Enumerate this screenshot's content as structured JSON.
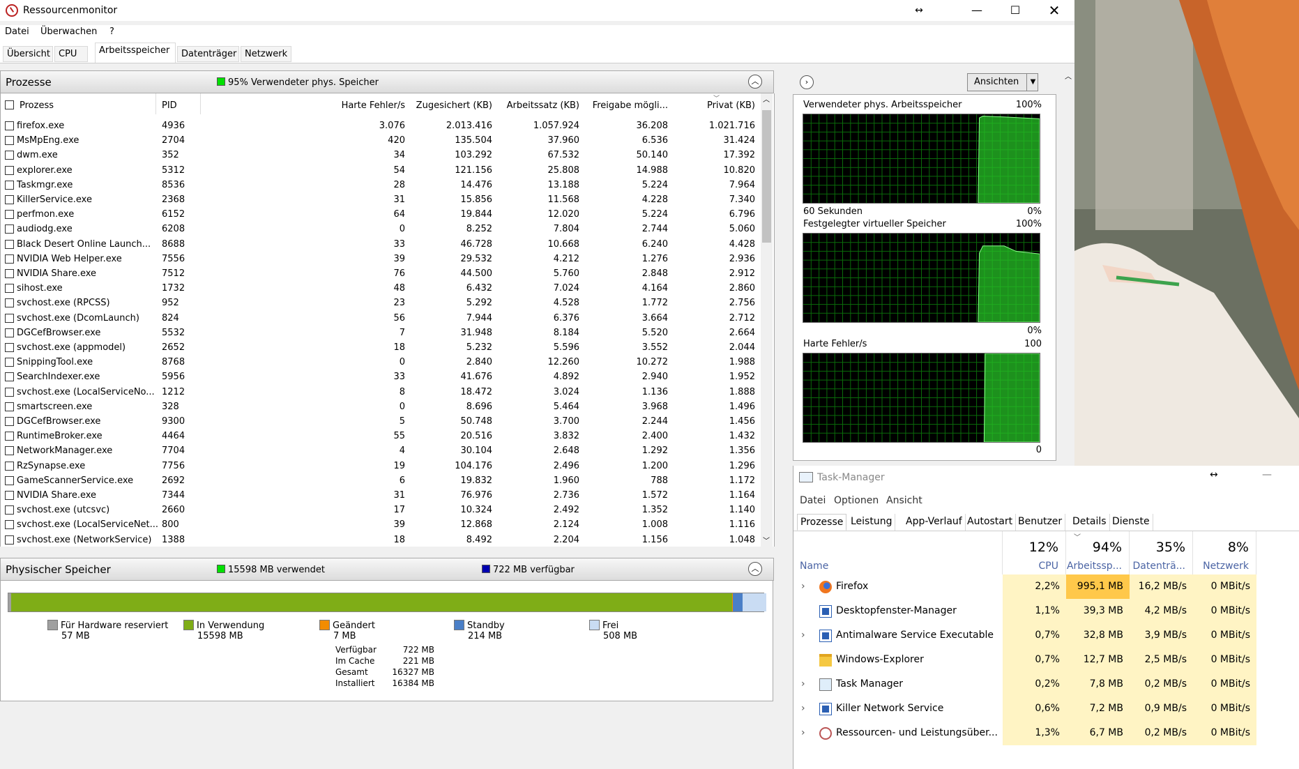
{
  "window": {
    "title": "Ressourcenmonitor"
  },
  "menu": [
    "Datei",
    "Überwachen",
    "?"
  ],
  "tabs": [
    "Übersicht",
    "CPU",
    "Arbeitsspeicher",
    "Datenträger",
    "Netzwerk"
  ],
  "processes": {
    "title": "Prozesse",
    "status": "95% Verwendeter phys. Speicher",
    "columns": [
      "Prozess",
      "PID",
      "Harte Fehler/s",
      "Zugesichert (KB)",
      "Arbeitssatz (KB)",
      "Freigabe mögli...",
      "Privat (KB)"
    ],
    "rows": [
      [
        "firefox.exe",
        "4936",
        "3.076",
        "2.013.416",
        "1.057.924",
        "36.208",
        "1.021.716"
      ],
      [
        "MsMpEng.exe",
        "2704",
        "420",
        "135.504",
        "37.960",
        "6.536",
        "31.424"
      ],
      [
        "dwm.exe",
        "352",
        "34",
        "103.292",
        "67.532",
        "50.140",
        "17.392"
      ],
      [
        "explorer.exe",
        "5312",
        "54",
        "121.156",
        "25.808",
        "14.988",
        "10.820"
      ],
      [
        "Taskmgr.exe",
        "8536",
        "28",
        "14.476",
        "13.188",
        "5.224",
        "7.964"
      ],
      [
        "KillerService.exe",
        "2368",
        "31",
        "15.856",
        "11.568",
        "4.228",
        "7.340"
      ],
      [
        "perfmon.exe",
        "6152",
        "64",
        "19.844",
        "12.020",
        "5.224",
        "6.796"
      ],
      [
        "audiodg.exe",
        "6208",
        "0",
        "8.252",
        "7.804",
        "2.744",
        "5.060"
      ],
      [
        "Black Desert Online Launch...",
        "8688",
        "33",
        "46.728",
        "10.668",
        "6.240",
        "4.428"
      ],
      [
        "NVIDIA Web Helper.exe",
        "7556",
        "39",
        "29.532",
        "4.212",
        "1.276",
        "2.936"
      ],
      [
        "NVIDIA Share.exe",
        "7512",
        "76",
        "44.500",
        "5.760",
        "2.848",
        "2.912"
      ],
      [
        "sihost.exe",
        "1732",
        "48",
        "6.432",
        "7.024",
        "4.164",
        "2.860"
      ],
      [
        "svchost.exe (RPCSS)",
        "952",
        "23",
        "5.292",
        "4.528",
        "1.772",
        "2.756"
      ],
      [
        "svchost.exe (DcomLaunch)",
        "824",
        "56",
        "7.944",
        "6.376",
        "3.664",
        "2.712"
      ],
      [
        "DGCefBrowser.exe",
        "5532",
        "7",
        "31.948",
        "8.184",
        "5.520",
        "2.664"
      ],
      [
        "svchost.exe (appmodel)",
        "2652",
        "18",
        "5.232",
        "5.596",
        "3.552",
        "2.044"
      ],
      [
        "SnippingTool.exe",
        "8768",
        "0",
        "2.840",
        "12.260",
        "10.272",
        "1.988"
      ],
      [
        "SearchIndexer.exe",
        "5956",
        "33",
        "41.676",
        "4.892",
        "2.940",
        "1.952"
      ],
      [
        "svchost.exe (LocalServiceNo...",
        "1212",
        "8",
        "18.472",
        "3.024",
        "1.136",
        "1.888"
      ],
      [
        "smartscreen.exe",
        "328",
        "0",
        "8.696",
        "5.464",
        "3.968",
        "1.496"
      ],
      [
        "DGCefBrowser.exe",
        "9300",
        "5",
        "50.748",
        "3.700",
        "2.244",
        "1.456"
      ],
      [
        "RuntimeBroker.exe",
        "4464",
        "55",
        "20.516",
        "3.832",
        "2.400",
        "1.432"
      ],
      [
        "NetworkManager.exe",
        "7704",
        "4",
        "30.104",
        "2.648",
        "1.292",
        "1.356"
      ],
      [
        "RzSynapse.exe",
        "7756",
        "19",
        "104.176",
        "2.496",
        "1.200",
        "1.296"
      ],
      [
        "GameScannerService.exe",
        "2692",
        "6",
        "19.832",
        "1.960",
        "788",
        "1.172"
      ],
      [
        "NVIDIA Share.exe",
        "7344",
        "31",
        "76.976",
        "2.736",
        "1.572",
        "1.164"
      ],
      [
        "svchost.exe (utcsvc)",
        "2660",
        "17",
        "10.324",
        "2.492",
        "1.352",
        "1.140"
      ],
      [
        "svchost.exe (LocalServiceNet...",
        "800",
        "39",
        "12.868",
        "2.124",
        "1.008",
        "1.116"
      ],
      [
        "svchost.exe (NetworkService)",
        "1388",
        "18",
        "8.492",
        "2.204",
        "1.156",
        "1.048"
      ]
    ]
  },
  "physical_memory": {
    "title": "Physischer Speicher",
    "used_label": "15598 MB verwendet",
    "avail_label": "722 MB verfügbar",
    "legend": [
      {
        "label": "Für Hardware reserviert",
        "value": "57 MB",
        "color": "#a0a0a0"
      },
      {
        "label": "In Verwendung",
        "value": "15598 MB",
        "color": "#7fad17"
      },
      {
        "label": "Geändert",
        "value": "7 MB",
        "color": "#f28c00"
      },
      {
        "label": "Standby",
        "value": "214 MB",
        "color": "#4a7fc7"
      },
      {
        "label": "Frei",
        "value": "508 MB",
        "color": "#c9dcf3"
      }
    ],
    "stats": [
      {
        "label": "Verfügbar",
        "value": "722 MB"
      },
      {
        "label": "Im Cache",
        "value": "221 MB"
      },
      {
        "label": "Gesamt",
        "value": "16327 MB"
      },
      {
        "label": "Installiert",
        "value": "16384 MB"
      }
    ],
    "bar_fractions": {
      "reserved": 0.0035,
      "in_use": 0.955,
      "modified": 0.0004,
      "standby": 0.013,
      "free": 0.031
    }
  },
  "graphs": {
    "views_button": "Ansichten",
    "g1": {
      "title": "Verwendeter phys. Arbeitsspeicher",
      "top": "100%",
      "bottom": "0%",
      "footer": "60 Sekunden"
    },
    "g2": {
      "title": "Festgelegter virtueller Speicher",
      "top": "100%",
      "bottom": "0%"
    },
    "g3": {
      "title": "Harte Fehler/s",
      "top": "100",
      "bottom": "0"
    }
  },
  "taskmgr": {
    "title": "Task-Manager",
    "menu": [
      "Datei",
      "Optionen",
      "Ansicht"
    ],
    "tabs": [
      "Prozesse",
      "Leistung",
      "App-Verlauf",
      "Autostart",
      "Benutzer",
      "Details",
      "Dienste"
    ],
    "name_header": "Name",
    "columns": [
      {
        "pct": "12%",
        "name": "CPU"
      },
      {
        "pct": "94%",
        "name": "Arbeitssp..."
      },
      {
        "pct": "35%",
        "name": "Datenträ..."
      },
      {
        "pct": "8%",
        "name": "Netzwerk"
      }
    ],
    "rows": [
      {
        "name": "Firefox",
        "expand": true,
        "icon": "firefox-icon",
        "cpu": "2,2%",
        "mem": "995,1 MB",
        "disk": "16,2 MB/s",
        "net": "0 MBit/s"
      },
      {
        "name": "Desktopfenster-Manager",
        "expand": false,
        "icon": "window-icon",
        "cpu": "1,1%",
        "mem": "39,3 MB",
        "disk": "4,2 MB/s",
        "net": "0 MBit/s"
      },
      {
        "name": "Antimalware Service Executable",
        "expand": true,
        "icon": "window-icon",
        "cpu": "0,7%",
        "mem": "32,8 MB",
        "disk": "3,9 MB/s",
        "net": "0 MBit/s"
      },
      {
        "name": "Windows-Explorer",
        "expand": false,
        "icon": "folder-icon",
        "cpu": "0,7%",
        "mem": "12,7 MB",
        "disk": "2,5 MB/s",
        "net": "0 MBit/s"
      },
      {
        "name": "Task Manager",
        "expand": true,
        "icon": "taskmgr-icon",
        "cpu": "0,2%",
        "mem": "7,8 MB",
        "disk": "0,2 MB/s",
        "net": "0 MBit/s"
      },
      {
        "name": "Killer Network Service",
        "expand": true,
        "icon": "window-icon",
        "cpu": "0,6%",
        "mem": "7,2 MB",
        "disk": "0,9 MB/s",
        "net": "0 MBit/s"
      },
      {
        "name": "Ressourcen- und Leistungsüber...",
        "expand": true,
        "icon": "resmon-icon",
        "cpu": "1,3%",
        "mem": "6,7 MB",
        "disk": "0,2 MB/s",
        "net": "0 MBit/s"
      }
    ]
  }
}
